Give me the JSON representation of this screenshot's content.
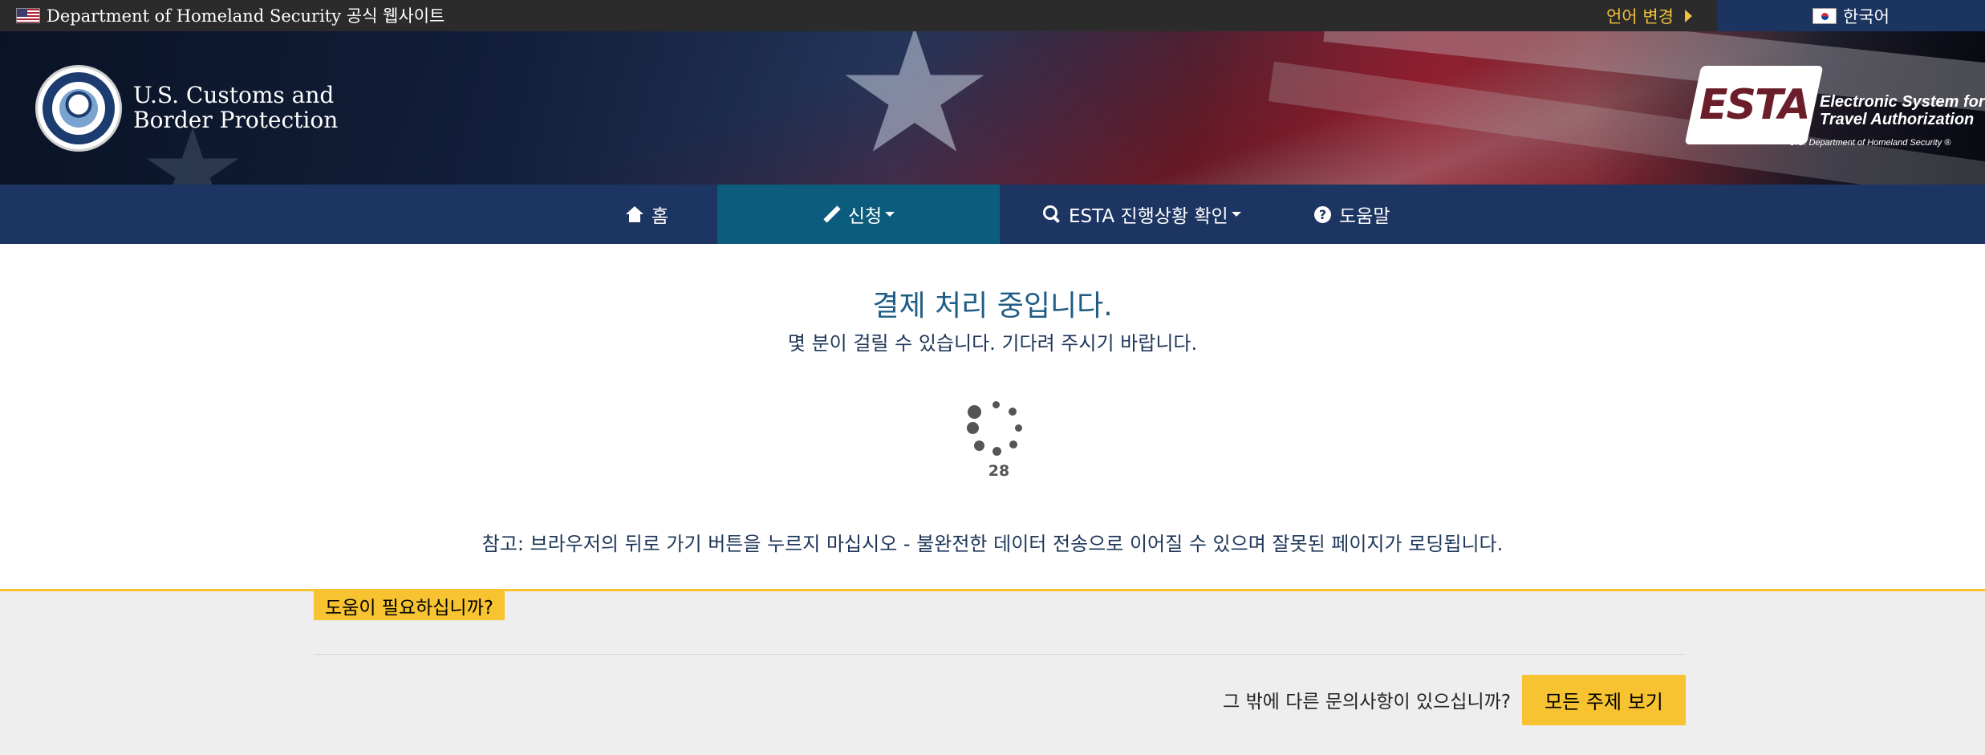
{
  "topbar": {
    "official_site": "Department of Homeland Security 공식 웹사이트",
    "change_language": "언어 변경",
    "current_language": "한국어"
  },
  "header": {
    "agency_name_line1": "U.S. Customs and",
    "agency_name_line2": "Border Protection",
    "esta_logo_text": "ESTA",
    "esta_subtitle_line1": "Electronic System for",
    "esta_subtitle_line2": "Travel Authorization",
    "esta_dhs_text": "U.S. Department of Homeland Security ®"
  },
  "nav": {
    "items": [
      {
        "label": "홈",
        "icon": "home-icon"
      },
      {
        "label": "신청",
        "icon": "pencil-icon",
        "dropdown": true,
        "active": true
      },
      {
        "label": "ESTA 진행상황 확인",
        "icon": "search-icon",
        "dropdown": true
      },
      {
        "label": "도움말",
        "icon": "question-circle-icon"
      }
    ]
  },
  "main": {
    "title": "결제 처리 중입니다.",
    "subtitle": "몇 분이 걸릴 수 있습니다. 기다려 주시기 바랍니다.",
    "countdown": "28",
    "note": "참고: 브라우저의 뒤로 가기 버튼을 누르지 마십시오 - 불완전한 데이터 전송으로 이어질 수 있으며 잘못된 페이지가 로딩됩니다."
  },
  "help": {
    "tag": "도움이 필요하십니까?",
    "other_question": "그 밖에 다른 문의사항이 있으십니까?",
    "all_topics_button": "모든 주제 보기"
  },
  "colors": {
    "nav_bg": "#1d3562",
    "nav_active": "#0c5c7e",
    "accent_yellow": "#f7c331",
    "title_blue": "#1f5d85"
  }
}
